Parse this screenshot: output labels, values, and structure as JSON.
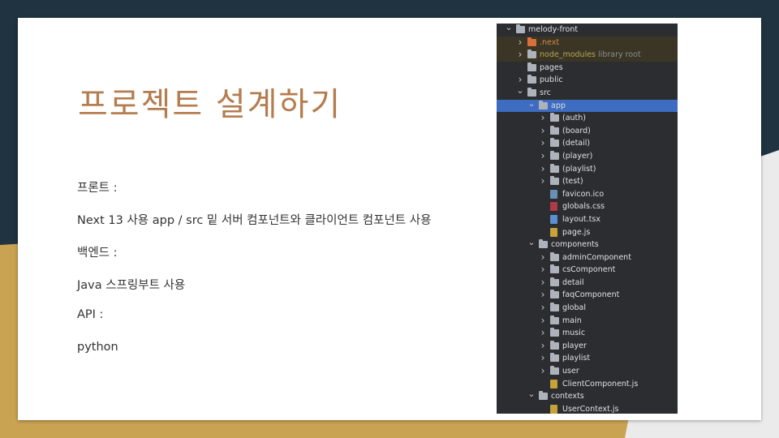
{
  "slide": {
    "title": "프로젝트 설계하기",
    "lines": [
      "프론트 :",
      "Next 13 사용 app / src 밑 서버 컴포넌트와 클라이언트 컴포넌트 사용",
      "백엔드 :",
      "Java 스프링부트 사용",
      "API :",
      "python"
    ]
  },
  "tree": {
    "rows": [
      {
        "label": "melody-front",
        "depth": 0,
        "chevron": "v",
        "icon": "folder"
      },
      {
        "label": ".next",
        "depth": 1,
        "chevron": ">",
        "icon": "folder-orange",
        "style": "orange",
        "bg": "dark"
      },
      {
        "label": "node_modules",
        "suffix": "library root",
        "depth": 1,
        "chevron": ">",
        "icon": "folder",
        "style": "yellow",
        "bg": "dark"
      },
      {
        "label": "pages",
        "depth": 1,
        "chevron": "",
        "icon": "folder"
      },
      {
        "label": "public",
        "depth": 1,
        "chevron": ">",
        "icon": "folder"
      },
      {
        "label": "src",
        "depth": 1,
        "chevron": "v",
        "icon": "folder"
      },
      {
        "label": "app",
        "depth": 2,
        "chevron": "v",
        "icon": "folder",
        "bg": "sel"
      },
      {
        "label": "(auth)",
        "depth": 3,
        "chevron": ">",
        "icon": "folder"
      },
      {
        "label": "(board)",
        "depth": 3,
        "chevron": ">",
        "icon": "folder"
      },
      {
        "label": "(detail)",
        "depth": 3,
        "chevron": ">",
        "icon": "folder"
      },
      {
        "label": "(player)",
        "depth": 3,
        "chevron": ">",
        "icon": "folder"
      },
      {
        "label": "(playlist)",
        "depth": 3,
        "chevron": ">",
        "icon": "folder"
      },
      {
        "label": "(test)",
        "depth": 3,
        "chevron": ">",
        "icon": "folder"
      },
      {
        "label": "favicon.ico",
        "depth": 3,
        "chevron": "",
        "icon": "file-icon"
      },
      {
        "label": "globals.css",
        "depth": 3,
        "chevron": "",
        "icon": "file-css"
      },
      {
        "label": "layout.tsx",
        "depth": 3,
        "chevron": "",
        "icon": "file-tsx"
      },
      {
        "label": "page.js",
        "depth": 3,
        "chevron": "",
        "icon": "file-js"
      },
      {
        "label": "components",
        "depth": 2,
        "chevron": "v",
        "icon": "folder"
      },
      {
        "label": "adminComponent",
        "depth": 3,
        "chevron": ">",
        "icon": "folder"
      },
      {
        "label": "csComponent",
        "depth": 3,
        "chevron": ">",
        "icon": "folder"
      },
      {
        "label": "detail",
        "depth": 3,
        "chevron": ">",
        "icon": "folder"
      },
      {
        "label": "faqComponent",
        "depth": 3,
        "chevron": ">",
        "icon": "folder"
      },
      {
        "label": "global",
        "depth": 3,
        "chevron": ">",
        "icon": "folder"
      },
      {
        "label": "main",
        "depth": 3,
        "chevron": ">",
        "icon": "folder"
      },
      {
        "label": "music",
        "depth": 3,
        "chevron": ">",
        "icon": "folder"
      },
      {
        "label": "player",
        "depth": 3,
        "chevron": ">",
        "icon": "folder"
      },
      {
        "label": "playlist",
        "depth": 3,
        "chevron": ">",
        "icon": "folder"
      },
      {
        "label": "user",
        "depth": 3,
        "chevron": ">",
        "icon": "folder"
      },
      {
        "label": "ClientComponent.js",
        "depth": 3,
        "chevron": "",
        "icon": "file-js"
      },
      {
        "label": "contexts",
        "depth": 2,
        "chevron": "v",
        "icon": "folder"
      },
      {
        "label": "UserContext.js",
        "depth": 3,
        "chevron": "",
        "icon": "file-js"
      }
    ]
  }
}
